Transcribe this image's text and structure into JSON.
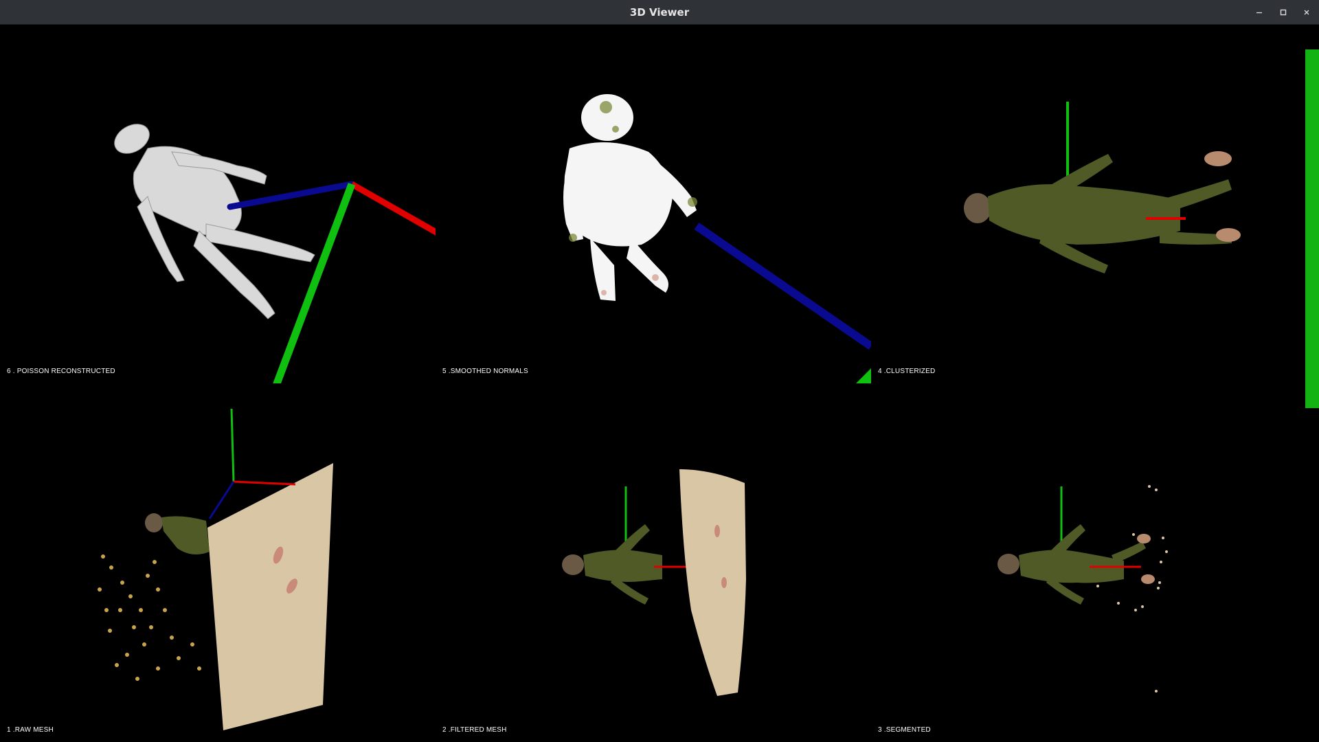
{
  "window": {
    "title": "3D Viewer",
    "controls": {
      "minimize_icon": "minimize-icon",
      "maximize_icon": "maximize-icon",
      "close_icon": "close-icon"
    }
  },
  "viewports": [
    {
      "id": "poisson",
      "label": "6 . POISSON RECONSTRUCTED"
    },
    {
      "id": "smoothed",
      "label": "5 .SMOOTHED NORMALS"
    },
    {
      "id": "clusterized",
      "label": "4 .CLUSTERIZED"
    },
    {
      "id": "raw",
      "label": "1 .RAW MESH"
    },
    {
      "id": "filtered",
      "label": "2 .FILTERED MESH"
    },
    {
      "id": "segmented",
      "label": "3 .SEGMENTED"
    }
  ],
  "colors": {
    "background": "#000000",
    "titlebar": "#2f3237",
    "axis_x": "#e00000",
    "axis_y": "#10c010",
    "axis_z": "#0a0a90",
    "mesh_gray": "#d9d9d9",
    "cloud_white": "#f5f5f5",
    "suit_green": "#4f5a26",
    "wall_beige": "#d9c6a4",
    "scatter_gold": "#c9a54a",
    "scrollbar": "#14b314"
  }
}
